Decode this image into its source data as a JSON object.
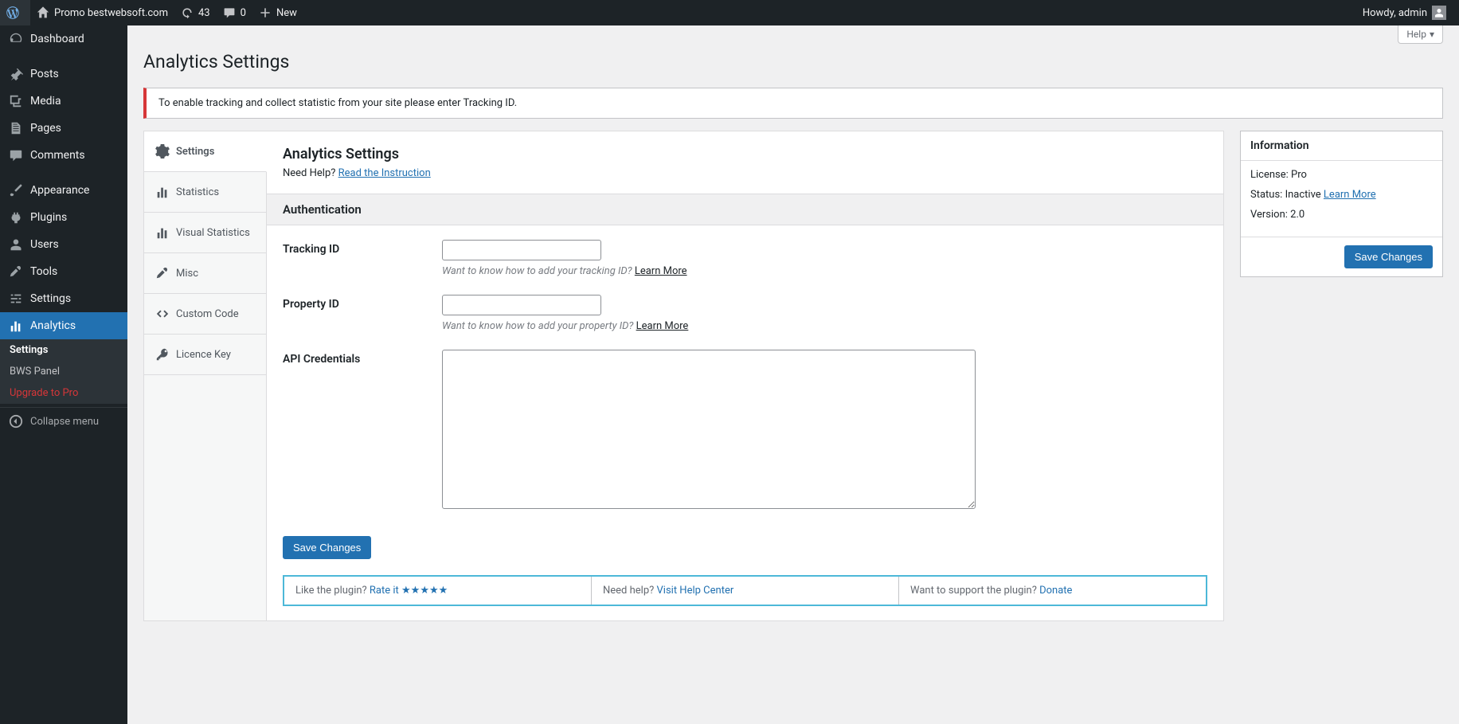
{
  "adminbar": {
    "site_name": "Promo bestwebsoft.com",
    "updates_count": "43",
    "comments_count": "0",
    "new_label": "New",
    "howdy": "Howdy, admin"
  },
  "sidebar": {
    "items": [
      {
        "label": "Dashboard"
      },
      {
        "label": "Posts"
      },
      {
        "label": "Media"
      },
      {
        "label": "Pages"
      },
      {
        "label": "Comments"
      },
      {
        "label": "Appearance"
      },
      {
        "label": "Plugins"
      },
      {
        "label": "Users"
      },
      {
        "label": "Tools"
      },
      {
        "label": "Settings"
      },
      {
        "label": "Analytics"
      }
    ],
    "submenu": [
      {
        "label": "Settings"
      },
      {
        "label": "BWS Panel"
      },
      {
        "label": "Upgrade to Pro"
      }
    ],
    "collapse": "Collapse menu"
  },
  "help_tab": "Help",
  "page_title": "Analytics Settings",
  "notice": "To enable tracking and collect statistic from your site please enter Tracking ID.",
  "tabs": [
    {
      "label": "Settings"
    },
    {
      "label": "Statistics"
    },
    {
      "label": "Visual Statistics"
    },
    {
      "label": "Misc"
    },
    {
      "label": "Custom Code"
    },
    {
      "label": "Licence Key"
    }
  ],
  "panel": {
    "heading": "Analytics Settings",
    "need_help": "Need Help?",
    "instruction_link": "Read the Instruction",
    "section_auth": "Authentication",
    "tracking_label": "Tracking ID",
    "tracking_hint": "Want to know how to add your tracking ID?",
    "property_label": "Property ID",
    "property_hint": "Want to know how to add your property ID?",
    "api_label": "API Credentials",
    "learn_more": "Learn More",
    "save": "Save Changes"
  },
  "info_box": {
    "title": "Information",
    "license_label": "License:",
    "license_value": "Pro",
    "status_label": "Status:",
    "status_value": "Inactive",
    "status_link": "Learn More",
    "version_label": "Version:",
    "version_value": "2.0",
    "save": "Save Changes"
  },
  "footer": {
    "like": "Like the plugin?",
    "rate": "Rate it",
    "need_help": "Need help?",
    "help_center": "Visit Help Center",
    "support": "Want to support the plugin?",
    "donate": "Donate"
  }
}
